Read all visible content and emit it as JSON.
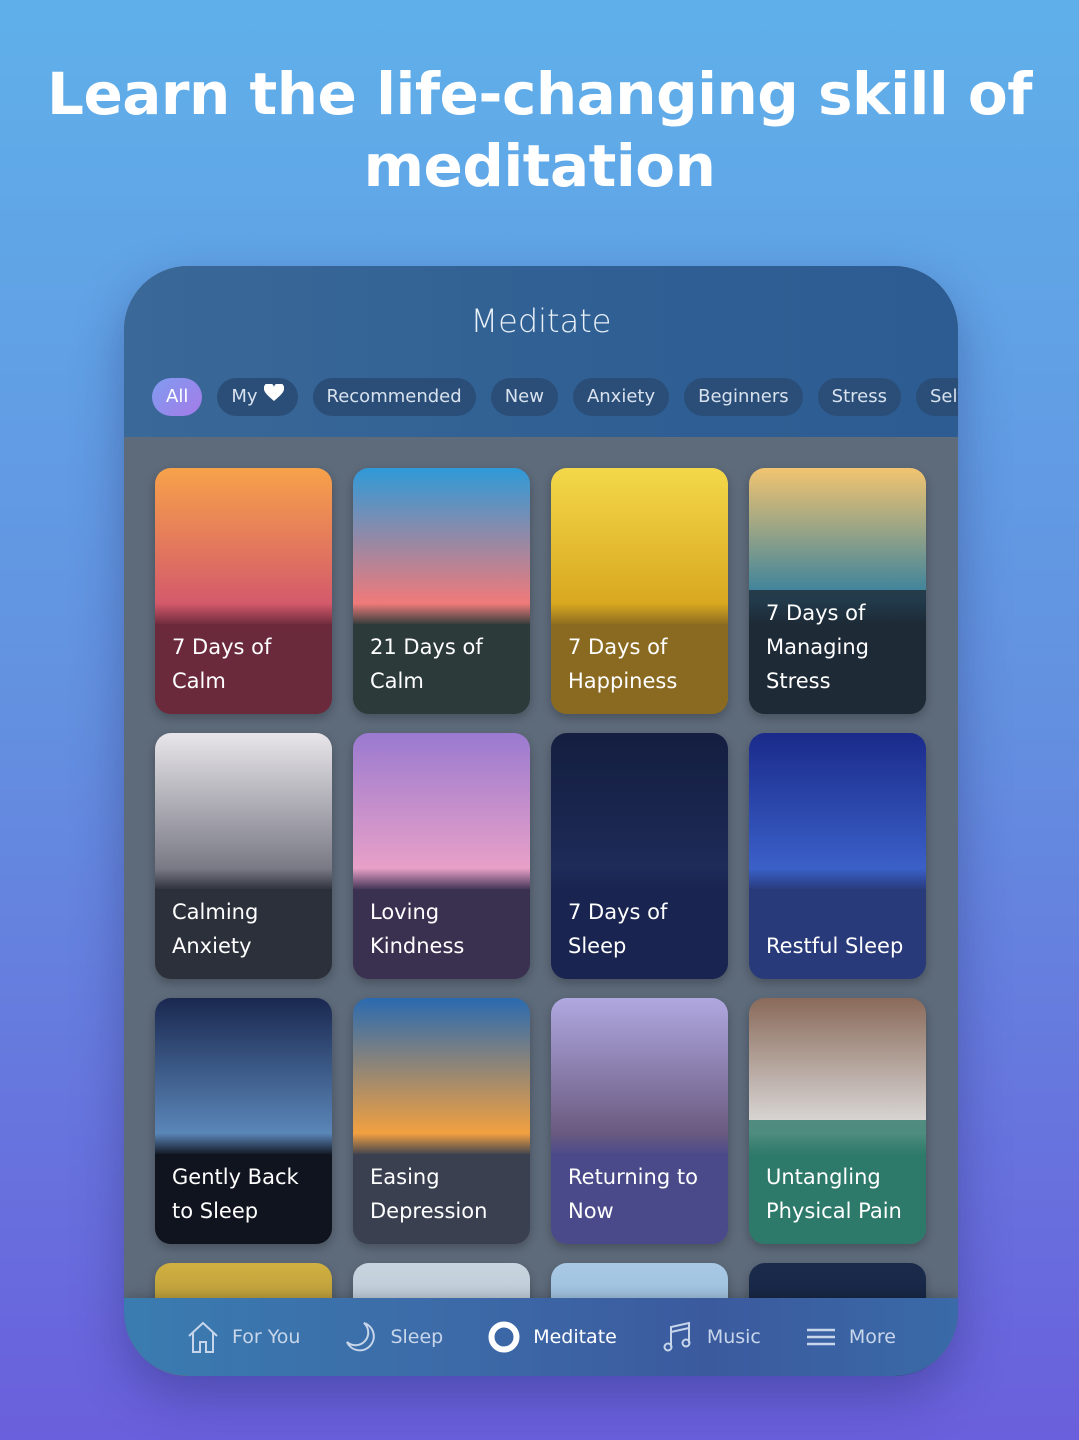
{
  "headline": "Learn the life-changing skill of meditation",
  "screen": {
    "title": "Meditate"
  },
  "chips": [
    {
      "label": "All",
      "active": true
    },
    {
      "label": "My",
      "heart": true
    },
    {
      "label": "Recommended"
    },
    {
      "label": "New"
    },
    {
      "label": "Anxiety"
    },
    {
      "label": "Beginners"
    },
    {
      "label": "Stress"
    },
    {
      "label": "Self-Ca"
    }
  ],
  "cards": [
    {
      "title": "7 Days of Calm",
      "colors": [
        "#f7a24a",
        "#d45a6b",
        "#6b2a3c"
      ]
    },
    {
      "title": "21 Days of Calm",
      "colors": [
        "#2e9ad8",
        "#f07a7a",
        "#2c3a3a"
      ]
    },
    {
      "title": "7 Days of Happiness",
      "colors": [
        "#f4d84a",
        "#d8a820",
        "#8a6a20"
      ]
    },
    {
      "title": "7 Days of Managing Stress",
      "colors": [
        "#f2c470",
        "#2e7ea0",
        "#1e2a36"
      ]
    },
    {
      "title": "Calming Anxiety",
      "colors": [
        "#e8e6ea",
        "#7a7a86",
        "#2c303a"
      ]
    },
    {
      "title": "Loving Kindness",
      "colors": [
        "#9a7ad0",
        "#e8a0c8",
        "#3a3050"
      ]
    },
    {
      "title": "7 Days of Sleep",
      "colors": [
        "#141e40",
        "#1e2a58",
        "#1a2450"
      ]
    },
    {
      "title": "Restful Sleep",
      "colors": [
        "#1a2a8a",
        "#3a60c8",
        "#283a7a"
      ]
    },
    {
      "title": "Gently Back to Sleep",
      "colors": [
        "#1a2850",
        "#5a86b8",
        "#10141e"
      ]
    },
    {
      "title": "Easing Depression",
      "colors": [
        "#2a6ab0",
        "#f2a040",
        "#3a4050"
      ]
    },
    {
      "title": "Returning to Now",
      "colors": [
        "#b0a8e0",
        "#6a5a80",
        "#4a4a8a"
      ]
    },
    {
      "title": "Untangling Physical Pain",
      "colors": [
        "#8a6a5a",
        "#e0e0e0",
        "#2e7a6a"
      ]
    },
    {
      "title": "",
      "colors": [
        "#d0b040",
        "#8a7030",
        "#8a7030"
      ]
    },
    {
      "title": "",
      "colors": [
        "#c8d4de",
        "#a8b8c8",
        "#a8b8c8"
      ]
    },
    {
      "title": "",
      "colors": [
        "#a8c8e4",
        "#88b0d4",
        "#88b0d4"
      ]
    },
    {
      "title": "",
      "colors": [
        "#1a2a4a",
        "#12203e",
        "#12203e"
      ]
    }
  ],
  "nav": [
    {
      "label": "For You",
      "icon": "home-icon"
    },
    {
      "label": "Sleep",
      "icon": "moon-icon"
    },
    {
      "label": "Meditate",
      "icon": "circle-icon",
      "active": true
    },
    {
      "label": "Music",
      "icon": "music-note-icon"
    },
    {
      "label": "More",
      "icon": "menu-icon"
    }
  ]
}
